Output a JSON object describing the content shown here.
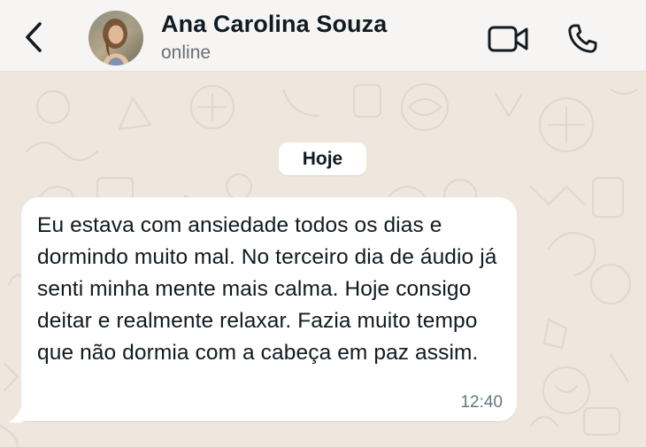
{
  "header": {
    "back_icon": "chevron-left-icon",
    "contact_name": "Ana Carolina Souza",
    "status": "online",
    "video_icon": "video-camera-icon",
    "call_icon": "phone-icon"
  },
  "chat": {
    "date_label": "Hoje",
    "messages": [
      {
        "direction": "incoming",
        "text": "Eu estava com ansiedade todos os dias e dormindo muito mal. No terceiro dia de áudio já senti minha mente mais calma. Hoje consigo deitar e realmente relaxar. Fazia muito tempo que não dormia com a cabeça em paz assim.",
        "time": "12:40"
      }
    ]
  },
  "colors": {
    "header_bg": "#f6f5f4",
    "chat_bg": "#efe7de",
    "bubble_bg": "#ffffff",
    "text": "#111b21",
    "secondary_text": "#667781"
  }
}
